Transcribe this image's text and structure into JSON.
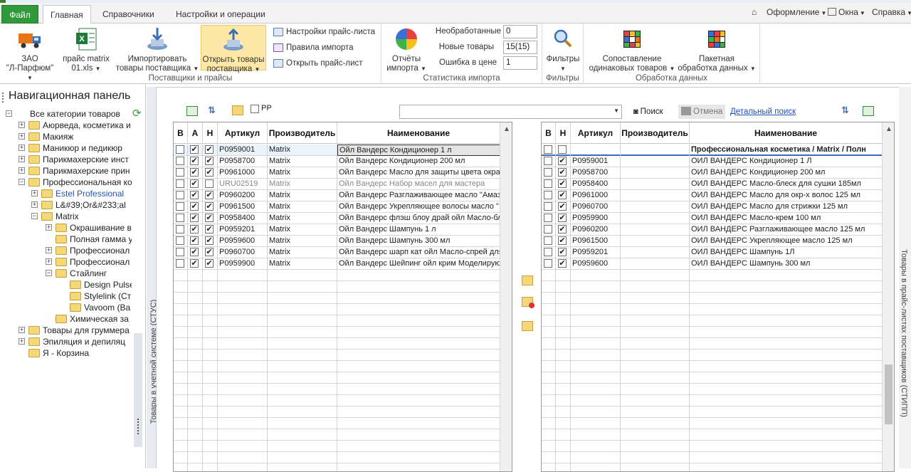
{
  "tabs": {
    "file": "Файл",
    "items": [
      "Главная",
      "Справочники",
      "Настройки и операции"
    ],
    "right": [
      "Оформление",
      "Окна",
      "Справка"
    ]
  },
  "ribbon": {
    "group1": {
      "title": "Поставщики и прайсы",
      "btn_supplier": [
        "ЗАО",
        "\"Л-Парфюм\""
      ],
      "btn_price": [
        "прайс matrix",
        "01.xls"
      ],
      "btn_import": [
        "Импортировать",
        "товары поставщика"
      ],
      "btn_open": [
        "Открыть товары",
        "поставщика"
      ],
      "small": [
        "Настройки прайс-листа",
        "Правила импорта",
        "Открыть прайс-лист"
      ]
    },
    "group2": {
      "title": "Статистика импорта",
      "btn_reports": [
        "Отчёты",
        "импорта"
      ],
      "labels": [
        "Необработанные",
        "Новые товары",
        "Ошибка в цене"
      ],
      "values": [
        "0",
        "15(15)",
        "1"
      ]
    },
    "group3": {
      "title": "Фильтры",
      "btn": "Фильтры"
    },
    "group4": {
      "title": "Обработка данных",
      "btn_match": [
        "Сопоставление",
        "одинаковых товаров"
      ],
      "btn_batch": [
        "Пакетная",
        "обработка данных"
      ]
    }
  },
  "nav": {
    "title": "Навигационная панель",
    "tree": [
      {
        "label": "Все категории товаров",
        "level": 0,
        "exp": "−"
      },
      {
        "label": "Аюрведа, косметика и",
        "level": 1,
        "exp": "+"
      },
      {
        "label": "Макияж",
        "level": 1,
        "exp": "+"
      },
      {
        "label": "Маникюр и педикюр",
        "level": 1,
        "exp": "+"
      },
      {
        "label": "Парикмахерские инст",
        "level": 1,
        "exp": "+"
      },
      {
        "label": "Парикмахерские прин",
        "level": 1,
        "exp": "+"
      },
      {
        "label": "Профессиональная ко",
        "level": 1,
        "exp": "−"
      },
      {
        "label": "Estel Professional",
        "level": 2,
        "exp": "+",
        "blue": true
      },
      {
        "label": "L&#39;Or&#233;al",
        "level": 2,
        "exp": "+"
      },
      {
        "label": "Matrix",
        "level": 2,
        "exp": "−"
      },
      {
        "label": "Окрашивание в",
        "level": 3,
        "exp": "+"
      },
      {
        "label": "Полная гамма у",
        "level": 3,
        "exp": ""
      },
      {
        "label": "Профессионал",
        "level": 3,
        "exp": "+"
      },
      {
        "label": "Профессионал",
        "level": 3,
        "exp": "+"
      },
      {
        "label": "Стайлинг",
        "level": 3,
        "exp": "−"
      },
      {
        "label": "Design Pulse",
        "level": 4,
        "exp": ""
      },
      {
        "label": "Stylelink (Ст",
        "level": 4,
        "exp": ""
      },
      {
        "label": "Vavoom (Ва",
        "level": 4,
        "exp": ""
      },
      {
        "label": "Химическая за",
        "level": 3,
        "exp": ""
      },
      {
        "label": "Товары для груммера",
        "level": 1,
        "exp": "+"
      },
      {
        "label": "Эпиляция и депиляц",
        "level": 1,
        "exp": "+"
      },
      {
        "label": "Я - Корзина",
        "level": 1,
        "exp": ""
      }
    ]
  },
  "side_labels": {
    "left": "Товары в учетной системе (СТУС)",
    "right": "Товары в прайс-листах поставщиков (СТИПП)"
  },
  "toolbar": {
    "pp_label": "PP",
    "search_button": "Поиск",
    "cancel_button": "Отмена",
    "detailed_search": "Детальный поиск"
  },
  "left_grid": {
    "headers": [
      "В",
      "А",
      "Н",
      "Артикул",
      "Производитель",
      "Наименование"
    ],
    "rows": [
      {
        "v": false,
        "a": true,
        "n": true,
        "article": "P0959001",
        "maker": "Matrix",
        "name": "Ойл Вандерс  Кондиционер 1 л",
        "sel": true
      },
      {
        "v": false,
        "a": true,
        "n": true,
        "article": "P0958700",
        "maker": "Matrix",
        "name": "Ойл Вандерс  Кондиционер 200 мл"
      },
      {
        "v": false,
        "a": true,
        "n": true,
        "article": "P0961000",
        "maker": "Matrix",
        "name": "Ойл Вандерс  Масло для защиты цвета окра"
      },
      {
        "v": false,
        "a": true,
        "n": false,
        "article": "URU02519",
        "maker": "Matrix",
        "name": "Ойл Вандерс  Набор масел для мастера",
        "gray": true
      },
      {
        "v": false,
        "a": true,
        "n": true,
        "article": "P0960200",
        "maker": "Matrix",
        "name": "Ойл Вандерс  Разглаживающее масло \"Амазо"
      },
      {
        "v": false,
        "a": true,
        "n": true,
        "article": "P0961500",
        "maker": "Matrix",
        "name": "Ойл Вандерс  Укрепляющее волосы масло \""
      },
      {
        "v": false,
        "a": true,
        "n": true,
        "article": "P0958400",
        "maker": "Matrix",
        "name": "Ойл Вандерс флэш блоу драй ойл  Масло-бле"
      },
      {
        "v": false,
        "a": true,
        "n": true,
        "article": "P0959201",
        "maker": "Matrix",
        "name": "Ойл Вандерс  Шампунь 1 л"
      },
      {
        "v": false,
        "a": true,
        "n": true,
        "article": "P0959600",
        "maker": "Matrix",
        "name": "Ойл Вандерс  Шампунь 300 мл"
      },
      {
        "v": false,
        "a": true,
        "n": true,
        "article": "P0960700",
        "maker": "Matrix",
        "name": "Ойл Вандерс шарп кат ойл  Масло-спрей для"
      },
      {
        "v": false,
        "a": true,
        "n": true,
        "article": "P0959900",
        "maker": "Matrix",
        "name": "Ойл Вандерс  Шейпинг ойл крим Моделирую"
      }
    ]
  },
  "right_grid": {
    "headers": [
      "В",
      "Н",
      "Артикул",
      "Производитель",
      "Наименование"
    ],
    "rows": [
      {
        "v": false,
        "n": false,
        "article": "",
        "maker": "",
        "name": "Профессиональная косметика / Matrix / Полн",
        "header": true
      },
      {
        "v": false,
        "n": true,
        "article": "P0959001",
        "maker": "",
        "name": "ОИЛ ВАНДЕРС Кондиционер 1 Л"
      },
      {
        "v": false,
        "n": true,
        "article": "P0958700",
        "maker": "",
        "name": "ОИЛ ВАНДЕРС Кондиционер 200 мл"
      },
      {
        "v": false,
        "n": true,
        "article": "P0958400",
        "maker": "",
        "name": "ОИЛ ВАНДЕРС Масло-блеск для сушки 185мл"
      },
      {
        "v": false,
        "n": true,
        "article": "P0961000",
        "maker": "",
        "name": "ОИЛ ВАНДЕРС Масло для окр-х волос 125 мл"
      },
      {
        "v": false,
        "n": true,
        "article": "P0960700",
        "maker": "",
        "name": "ОИЛ ВАНДЕРС Масло для стрижки 125 мл"
      },
      {
        "v": false,
        "n": true,
        "article": "P0959900",
        "maker": "",
        "name": "ОИЛ ВАНДЕРС Масло-крем 100 мл"
      },
      {
        "v": false,
        "n": true,
        "article": "P0960200",
        "maker": "",
        "name": "ОИЛ ВАНДЕРС Разглаживающее масло 125 мл"
      },
      {
        "v": false,
        "n": true,
        "article": "P0961500",
        "maker": "",
        "name": "ОИЛ ВАНДЕРС Укрепляющее масло 125 мл"
      },
      {
        "v": false,
        "n": true,
        "article": "P0959201",
        "maker": "",
        "name": "ОИЛ ВАНДЕРС Шампунь 1Л"
      },
      {
        "v": false,
        "n": true,
        "article": "P0959600",
        "maker": "",
        "name": "ОИЛ ВАНДЕРС Шампунь 300 мл"
      }
    ]
  },
  "colors": {
    "file_tab": "#2e9a3a",
    "active_button": "#fde8a8",
    "link": "#1f4fb5",
    "selection": "#eaf3fb"
  }
}
